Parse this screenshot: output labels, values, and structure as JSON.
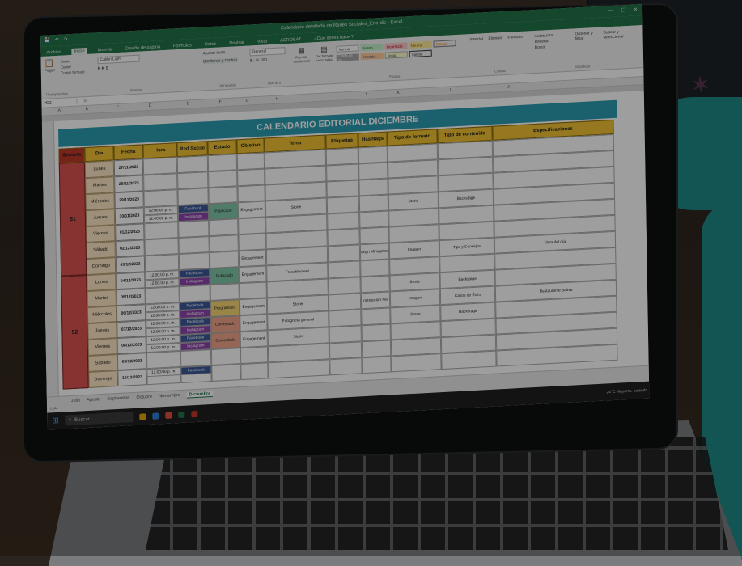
{
  "window": {
    "title": "Calendario detallado de Redes Sociales_Ene-dic - Excel"
  },
  "ribbon_tabs": [
    "Archivo",
    "Inicio",
    "Insertar",
    "Diseño de página",
    "Fórmulas",
    "Datos",
    "Revisar",
    "Vista",
    "ACROBAT",
    "¿Qué desea hacer?"
  ],
  "ribbon": {
    "paste": "Pegar",
    "cut": "Cortar",
    "copy": "Copiar",
    "format_painter": "Copiar formato",
    "font": "Calibri Light",
    "wrap": "Ajustar texto",
    "merge": "Combinar y centrar",
    "number_format": "General",
    "cond_format": "Formato condicional",
    "as_table": "Dar formato como tabla",
    "styles": {
      "normal": "Normal",
      "bueno": "Bueno",
      "incorrecto": "Incorrecto",
      "neutral": "Neutral",
      "calculo": "Cálculo",
      "celda_vinc": "Celda de co...",
      "entrada": "Entrada",
      "notas": "Notas",
      "salida": "Salida"
    },
    "insert": "Insertar",
    "delete": "Eliminar",
    "format": "Formato",
    "autosum": "Autosuma",
    "fill": "Rellenar",
    "clear": "Borrar",
    "sort": "Ordenar y filtrar",
    "find": "Buscar y seleccionar",
    "groups": {
      "clipboard": "Portapapeles",
      "font": "Fuente",
      "align": "Alineación",
      "number": "Número",
      "styles": "Estilos",
      "cells": "Celdas",
      "editing": "Modificar"
    }
  },
  "formula_bar": {
    "name_box": "H22",
    "fx": "fx"
  },
  "columns": [
    "A",
    "B",
    "C",
    "D",
    "E",
    "F",
    "G",
    "H",
    "I",
    "J",
    "K",
    "L",
    "M"
  ],
  "sheet_title": "CALENDARIO EDITORIAL DICIEMBRE",
  "headers": [
    "Semana",
    "Día",
    "Fecha",
    "Hora",
    "Red Social",
    "Estado",
    "Objetivo",
    "Tema",
    "Etiquetas",
    "Hashtags",
    "Tipo de formato",
    "Tipo de contenido",
    "Especificaciones"
  ],
  "weeks": [
    {
      "num": "51",
      "days": [
        {
          "day": "Lunes",
          "date": "27/11/2023"
        },
        {
          "day": "Martes",
          "date": "28/11/2023"
        },
        {
          "day": "Miércoles",
          "date": "29/11/2023"
        },
        {
          "day": "Jueves",
          "date": "30/11/2023"
        },
        {
          "day": "Viernes",
          "date": "01/12/2023"
        },
        {
          "day": "Sábado",
          "date": "02/12/2023"
        },
        {
          "day": "Domingo",
          "date": "03/12/2023"
        }
      ]
    },
    {
      "num": "52",
      "days": [
        {
          "day": "Lunes",
          "date": "04/12/2023"
        },
        {
          "day": "Martes",
          "date": "05/12/2023"
        },
        {
          "day": "Miércoles",
          "date": "06/12/2023"
        },
        {
          "day": "Jueves",
          "date": "07/12/2023"
        },
        {
          "day": "Viernes",
          "date": "08/12/2023"
        },
        {
          "day": "Sábado",
          "date": "09/12/2023"
        },
        {
          "day": "Domingo",
          "date": "10/12/2023"
        }
      ]
    }
  ],
  "entries": {
    "e1": {
      "hora1": "12:00:00 p. m.",
      "hora2": "12:00:00 p. m.",
      "red1": "Facebook",
      "red2": "Instagram",
      "estado": "Publicado",
      "objetivo": "Engagement",
      "tema": "Storie",
      "formato": "Storie",
      "contenido": "Backstage"
    },
    "e2": {
      "objetivo": "Engagement",
      "hashtags": "Imgn Miniquitos",
      "formato": "Imagen",
      "contenido": "Tips y Consejos",
      "espec": "Vista del día"
    },
    "e3": {
      "hora1": "12:00:00 p. m.",
      "hora2": "12:00:00 p. m.",
      "red1": "Facebook",
      "red2": "Instagram",
      "estado": "Publicado",
      "objetivo": "Engagement",
      "tema": "Freestilomeet"
    },
    "e4": {
      "formato": "Storie",
      "contenido": "Backstage"
    },
    "e5": {
      "hora1": "12:00:00 p. m.",
      "hora2": "12:00:00 p. m.",
      "red1": "Facebook",
      "red2": "Instagram",
      "estado": "Programado",
      "objetivo": "Engagement",
      "tema": "Storie",
      "hashtags": "Instrucción #ex",
      "formato": "Imagen",
      "contenido": "Casos de Éxito",
      "espec": "Restaurante Sativa"
    },
    "e6": {
      "hora1": "12:00:00 p. m.",
      "hora2": "12:00:00 p. m.",
      "red1": "Facebook",
      "red2": "Instagram",
      "estado": "Comentado",
      "objetivo": "Engagement",
      "tema": "Fotografía general",
      "formato": "Storie",
      "contenido": "Backstage"
    },
    "e7": {
      "hora1": "12:00:00 p. m.",
      "hora2": "12:00:00 p. m.",
      "red1": "Facebook",
      "red2": "Instagram",
      "estado": "Comentado",
      "objetivo": "Engagement",
      "tema": "Storie"
    },
    "e8": {
      "hora1": "12:00:00 p. m.",
      "red1": "Facebook"
    }
  },
  "sheet_tabs": [
    "Julio",
    "Agosto",
    "Septiembre",
    "Octubre",
    "Noviembre",
    "Diciembre"
  ],
  "active_tab": "Diciembre",
  "status": "Listo",
  "taskbar": {
    "search": "Buscar",
    "weather": "24°C  Mayorm. soleado"
  }
}
